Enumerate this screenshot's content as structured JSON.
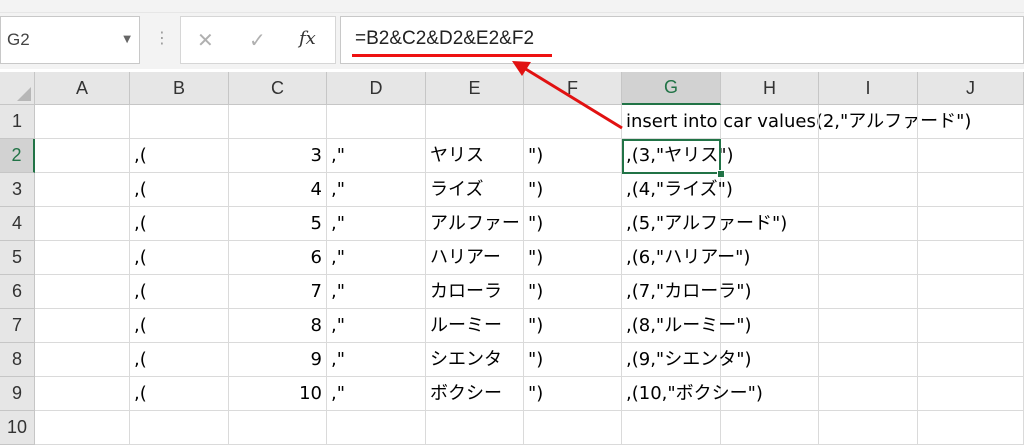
{
  "name_box": {
    "value": "G2"
  },
  "formula_bar": {
    "cancel_icon": "x-icon",
    "enter_icon": "check-icon",
    "fx_label": "fx",
    "formula": "=B2&C2&D2&E2&F2"
  },
  "annotation": {
    "color": "#e11111",
    "arrow_color": "#e11111"
  },
  "columns": [
    "A",
    "B",
    "C",
    "D",
    "E",
    "F",
    "G",
    "H",
    "I",
    "J"
  ],
  "selected_column": "G",
  "selected_row": "2",
  "rows": [
    {
      "num": "1",
      "A": "",
      "B": "",
      "C": "",
      "D": "",
      "E": "",
      "F": "",
      "G": "insert into car values(2,\"アルファード\")"
    },
    {
      "num": "2",
      "A": "",
      "B": ",(",
      "C": "3",
      "D": ",\"",
      "E": "ヤリス",
      "F": "\")",
      "G": ",(3,\"ヤリス\")"
    },
    {
      "num": "3",
      "A": "",
      "B": ",(",
      "C": "4",
      "D": ",\"",
      "E": "ライズ",
      "F": "\")",
      "G": ",(4,\"ライズ\")"
    },
    {
      "num": "4",
      "A": "",
      "B": ",(",
      "C": "5",
      "D": ",\"",
      "E": "アルファード",
      "F": "\")",
      "G": ",(5,\"アルファード\")"
    },
    {
      "num": "5",
      "A": "",
      "B": ",(",
      "C": "6",
      "D": ",\"",
      "E": "ハリアー",
      "F": "\")",
      "G": ",(6,\"ハリアー\")"
    },
    {
      "num": "6",
      "A": "",
      "B": ",(",
      "C": "7",
      "D": ",\"",
      "E": "カローラ",
      "F": "\")",
      "G": ",(7,\"カローラ\")"
    },
    {
      "num": "7",
      "A": "",
      "B": ",(",
      "C": "8",
      "D": ",\"",
      "E": "ルーミー",
      "F": "\")",
      "G": ",(8,\"ルーミー\")"
    },
    {
      "num": "8",
      "A": "",
      "B": ",(",
      "C": "9",
      "D": ",\"",
      "E": "シエンタ",
      "F": "\")",
      "G": ",(9,\"シエンタ\")"
    },
    {
      "num": "9",
      "A": "",
      "B": ",(",
      "C": "10",
      "D": ",\"",
      "E": "ボクシー",
      "F": "\")",
      "G": ",(10,\"ボクシー\")"
    },
    {
      "num": "10",
      "A": "",
      "B": "",
      "C": "",
      "D": "",
      "E": "",
      "F": "",
      "G": ""
    }
  ],
  "selection_color": "#217346"
}
